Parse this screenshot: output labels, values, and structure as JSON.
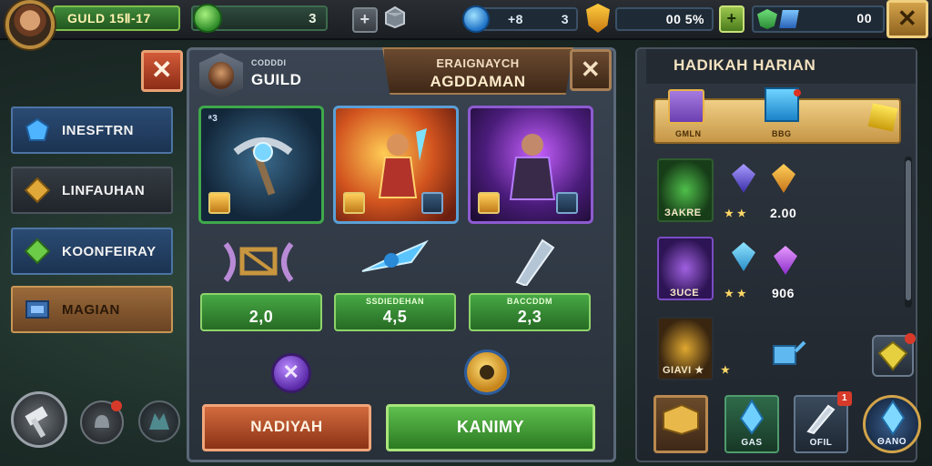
{
  "topbar": {
    "guild_label": "GULD 15Ⅱ-17",
    "gem_value": "3",
    "plus_label": "+",
    "mid_value": "+8",
    "mid_value2": "3",
    "percent_value": "00  5%",
    "plus_green_label": "+",
    "right_value": "00",
    "close_label": "✕"
  },
  "sidebar": {
    "close_label": "✕",
    "items": [
      {
        "label": "INESFTRN"
      },
      {
        "label": "LINFAUHAN"
      },
      {
        "label": "KOONFEIRAY"
      },
      {
        "label": "MAGIAN"
      }
    ]
  },
  "center": {
    "guild_sub": "CODDDI",
    "guild_title": "GUILD",
    "banner_line1": "ERAIGNAYCH",
    "banner_line2": "AGDDAMAN",
    "banner_close": "✕",
    "card1_tag": "ᵃ3",
    "stats": [
      {
        "sub": "",
        "value": "2,0"
      },
      {
        "sub": "SSDIEDEHAN",
        "value": "4,5"
      },
      {
        "sub": "BACCDDM",
        "value": "2,3"
      }
    ],
    "coin_symbol": "✕",
    "btn_left": "NADIYAH",
    "btn_right": "KANIMY"
  },
  "right_panel": {
    "title": "HADIKAH HARIAN",
    "reward_labels": [
      "GMLN",
      "BBG"
    ],
    "rows": [
      {
        "label": "ЗAKRE",
        "stars": "★ ★",
        "value": "2.00"
      },
      {
        "label": "ЗUCE",
        "stars": "★ ★",
        "value": "906"
      },
      {
        "label": "GIAVI ★",
        "stars": "★",
        "value": ""
      }
    ],
    "bottom": [
      {
        "label": ""
      },
      {
        "label": "GAS"
      },
      {
        "label": "OFIL",
        "badge": "1"
      },
      {
        "label": "ΘANO"
      }
    ]
  },
  "colors": {
    "accent_green": "#47a844",
    "accent_orange": "#d36b3e",
    "gold": "#d3a24a"
  },
  "icons": [
    "avatar",
    "gem-icon",
    "chest-icon",
    "blue-gem-icon",
    "gold-shield-icon",
    "hammer-icon",
    "bell-icon",
    "wolf-icon"
  ]
}
